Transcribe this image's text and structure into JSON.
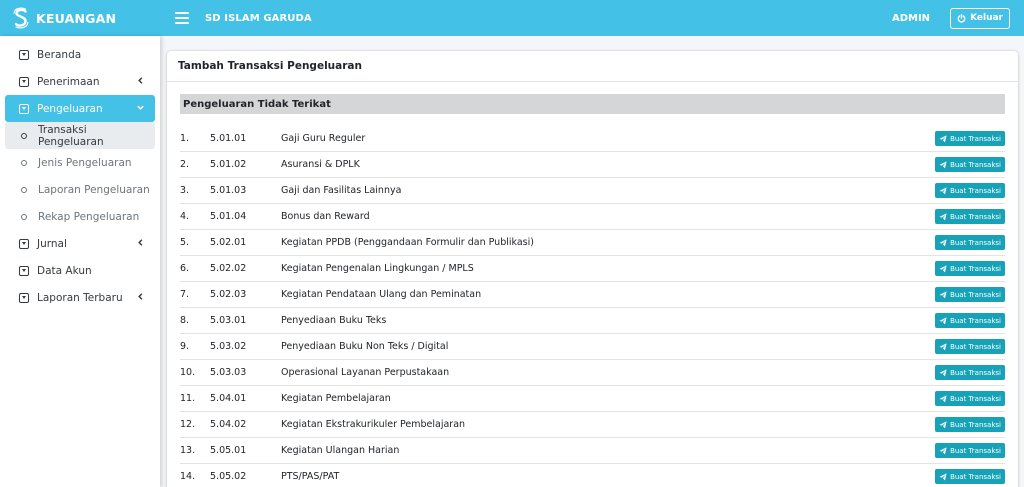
{
  "header": {
    "brand": "KEUANGAN",
    "school": "SD ISLAM GARUDA",
    "user": "ADMIN",
    "logout_label": "Keluar"
  },
  "sidebar": {
    "items": [
      {
        "label": "Beranda"
      },
      {
        "label": "Penerimaan"
      },
      {
        "label": "Pengeluaran"
      },
      {
        "label": "Transaksi Pengeluaran"
      },
      {
        "label": "Jenis Pengeluaran"
      },
      {
        "label": "Laporan Pengeluaran"
      },
      {
        "label": "Rekap Pengeluaran"
      },
      {
        "label": "Jurnal"
      },
      {
        "label": "Data Akun"
      },
      {
        "label": "Laporan Terbaru"
      }
    ]
  },
  "main": {
    "title": "Tambah Transaksi Pengeluaran",
    "section": "Pengeluaran Tidak Terikat",
    "button_label": "Buat Transaksi",
    "rows": [
      {
        "no": "1.",
        "code": "5.01.01",
        "name": "Gaji Guru Reguler"
      },
      {
        "no": "2.",
        "code": "5.01.02",
        "name": "Asuransi & DPLK"
      },
      {
        "no": "3.",
        "code": "5.01.03",
        "name": "Gaji dan Fasilitas Lainnya"
      },
      {
        "no": "4.",
        "code": "5.01.04",
        "name": "Bonus dan Reward"
      },
      {
        "no": "5.",
        "code": "5.02.01",
        "name": "Kegiatan PPDB (Penggandaan Formulir dan Publikasi)"
      },
      {
        "no": "6.",
        "code": "5.02.02",
        "name": "Kegiatan Pengenalan Lingkungan / MPLS"
      },
      {
        "no": "7.",
        "code": "5.02.03",
        "name": "Kegiatan Pendataan Ulang dan Peminatan"
      },
      {
        "no": "8.",
        "code": "5.03.01",
        "name": "Penyediaan Buku Teks"
      },
      {
        "no": "9.",
        "code": "5.03.02",
        "name": "Penyediaan Buku Non Teks / Digital"
      },
      {
        "no": "10.",
        "code": "5.03.03",
        "name": "Operasional Layanan Perpustakaan"
      },
      {
        "no": "11.",
        "code": "5.04.01",
        "name": "Kegiatan Pembelajaran"
      },
      {
        "no": "12.",
        "code": "5.04.02",
        "name": "Kegiatan Ekstrakurikuler Pembelajaran"
      },
      {
        "no": "13.",
        "code": "5.05.01",
        "name": "Kegiatan Ulangan Harian"
      },
      {
        "no": "14.",
        "code": "5.05.02",
        "name": "PTS/PAS/PAT"
      }
    ]
  },
  "colors": {
    "primary": "#44c1e6",
    "button": "#17a2b8",
    "section_bg": "#d4d6d8"
  }
}
